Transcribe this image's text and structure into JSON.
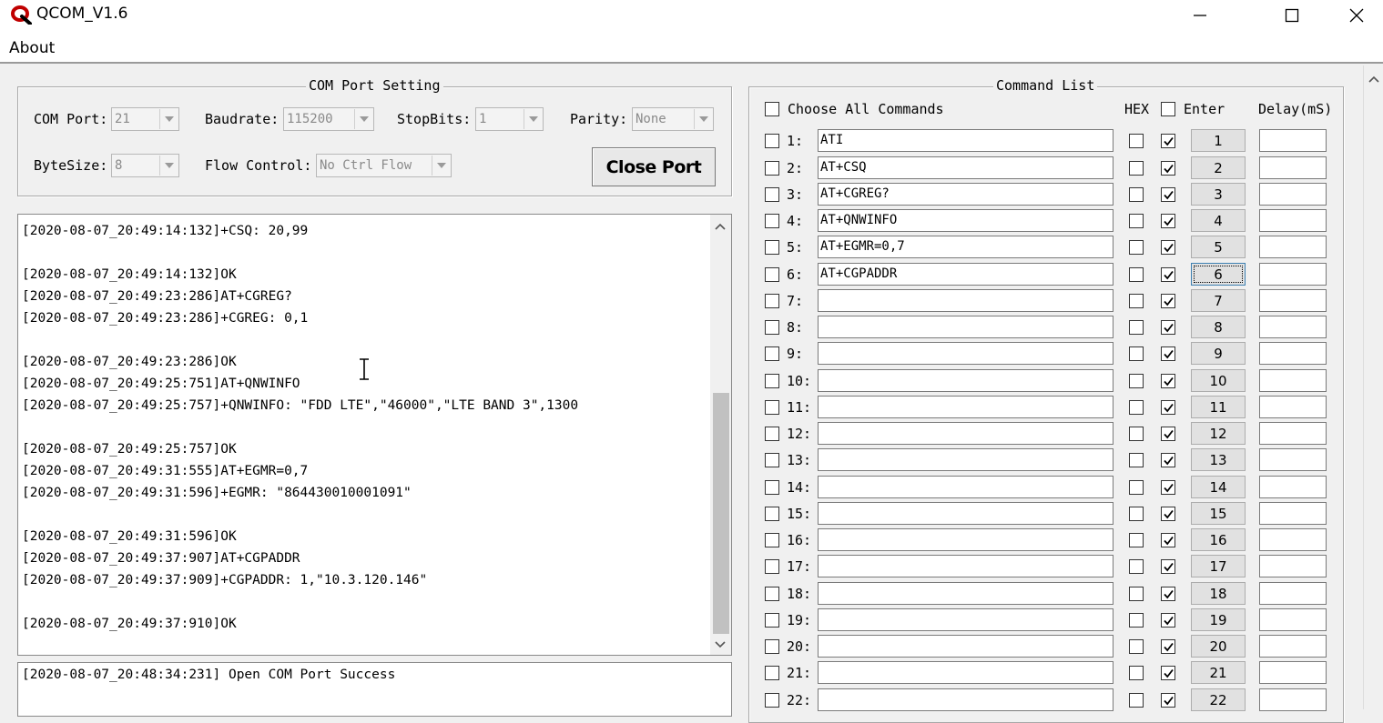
{
  "window": {
    "title": "QCOM_V1.6",
    "controls": {
      "minimize": "minimize-icon",
      "maximize": "maximize-icon",
      "close": "close-icon"
    }
  },
  "menu": {
    "about": "About"
  },
  "com_setting": {
    "title": "COM Port Setting",
    "com_port_label": "COM Port:",
    "com_port_value": "21",
    "baudrate_label": "Baudrate:",
    "baudrate_value": "115200",
    "stopbits_label": "StopBits:",
    "stopbits_value": "1",
    "parity_label": "Parity:",
    "parity_value": "None",
    "bytesize_label": "ByteSize:",
    "bytesize_value": "8",
    "flow_label": "Flow Control:",
    "flow_value": "No Ctrl Flow",
    "close_port_button": "Close Port"
  },
  "log": {
    "lines": [
      "[2020-08-07_20:49:14:132]+CSQ: 20,99",
      "",
      "[2020-08-07_20:49:14:132]OK",
      "[2020-08-07_20:49:23:286]AT+CGREG?",
      "[2020-08-07_20:49:23:286]+CGREG: 0,1",
      "",
      "[2020-08-07_20:49:23:286]OK",
      "[2020-08-07_20:49:25:751]AT+QNWINFO",
      "[2020-08-07_20:49:25:757]+QNWINFO: \"FDD LTE\",\"46000\",\"LTE BAND 3\",1300",
      "",
      "[2020-08-07_20:49:25:757]OK",
      "[2020-08-07_20:49:31:555]AT+EGMR=0,7",
      "[2020-08-07_20:49:31:596]+EGMR: \"864430010001091\"",
      "",
      "[2020-08-07_20:49:31:596]OK",
      "[2020-08-07_20:49:37:907]AT+CGPADDR",
      "[2020-08-07_20:49:37:909]+CGPADDR: 1,\"10.3.120.146\"",
      "",
      "[2020-08-07_20:49:37:910]OK"
    ]
  },
  "status": {
    "text": "[2020-08-07_20:48:34:231] Open COM Port Success"
  },
  "command_list": {
    "title": "Command List",
    "choose_all_label": "Choose All Commands",
    "hex_label": "HEX",
    "enter_label": "Enter",
    "delay_label": "Delay(mS)",
    "focused_row": 6,
    "rows": [
      {
        "num": "1:",
        "cmd": "ATI",
        "button": "1",
        "hex": false,
        "enter": true,
        "selected": false
      },
      {
        "num": "2:",
        "cmd": "AT+CSQ",
        "button": "2",
        "hex": false,
        "enter": true,
        "selected": false
      },
      {
        "num": "3:",
        "cmd": "AT+CGREG?",
        "button": "3",
        "hex": false,
        "enter": true,
        "selected": false
      },
      {
        "num": "4:",
        "cmd": "AT+QNWINFO",
        "button": "4",
        "hex": false,
        "enter": true,
        "selected": false
      },
      {
        "num": "5:",
        "cmd": "AT+EGMR=0,7",
        "button": "5",
        "hex": false,
        "enter": true,
        "selected": false
      },
      {
        "num": "6:",
        "cmd": "AT+CGPADDR",
        "button": "6",
        "hex": false,
        "enter": true,
        "selected": false
      },
      {
        "num": "7:",
        "cmd": "",
        "button": "7",
        "hex": false,
        "enter": true,
        "selected": false
      },
      {
        "num": "8:",
        "cmd": "",
        "button": "8",
        "hex": false,
        "enter": true,
        "selected": false
      },
      {
        "num": "9:",
        "cmd": "",
        "button": "9",
        "hex": false,
        "enter": true,
        "selected": false
      },
      {
        "num": "10:",
        "cmd": "",
        "button": "10",
        "hex": false,
        "enter": true,
        "selected": false
      },
      {
        "num": "11:",
        "cmd": "",
        "button": "11",
        "hex": false,
        "enter": true,
        "selected": false
      },
      {
        "num": "12:",
        "cmd": "",
        "button": "12",
        "hex": false,
        "enter": true,
        "selected": false
      },
      {
        "num": "13:",
        "cmd": "",
        "button": "13",
        "hex": false,
        "enter": true,
        "selected": false
      },
      {
        "num": "14:",
        "cmd": "",
        "button": "14",
        "hex": false,
        "enter": true,
        "selected": false
      },
      {
        "num": "15:",
        "cmd": "",
        "button": "15",
        "hex": false,
        "enter": true,
        "selected": false
      },
      {
        "num": "16:",
        "cmd": "",
        "button": "16",
        "hex": false,
        "enter": true,
        "selected": false
      },
      {
        "num": "17:",
        "cmd": "",
        "button": "17",
        "hex": false,
        "enter": true,
        "selected": false
      },
      {
        "num": "18:",
        "cmd": "",
        "button": "18",
        "hex": false,
        "enter": true,
        "selected": false
      },
      {
        "num": "19:",
        "cmd": "",
        "button": "19",
        "hex": false,
        "enter": true,
        "selected": false
      },
      {
        "num": "20:",
        "cmd": "",
        "button": "20",
        "hex": false,
        "enter": true,
        "selected": false
      },
      {
        "num": "21:",
        "cmd": "",
        "button": "21",
        "hex": false,
        "enter": true,
        "selected": false
      },
      {
        "num": "22:",
        "cmd": "",
        "button": "22",
        "hex": false,
        "enter": true,
        "selected": false
      }
    ]
  },
  "colors": {
    "window_bg": "#f0f0f0",
    "text": "#000000",
    "disabled_text": "#8a8a8a",
    "scroll_thumb": "#c1c1c1",
    "focus_border": "#3c7fb1"
  }
}
